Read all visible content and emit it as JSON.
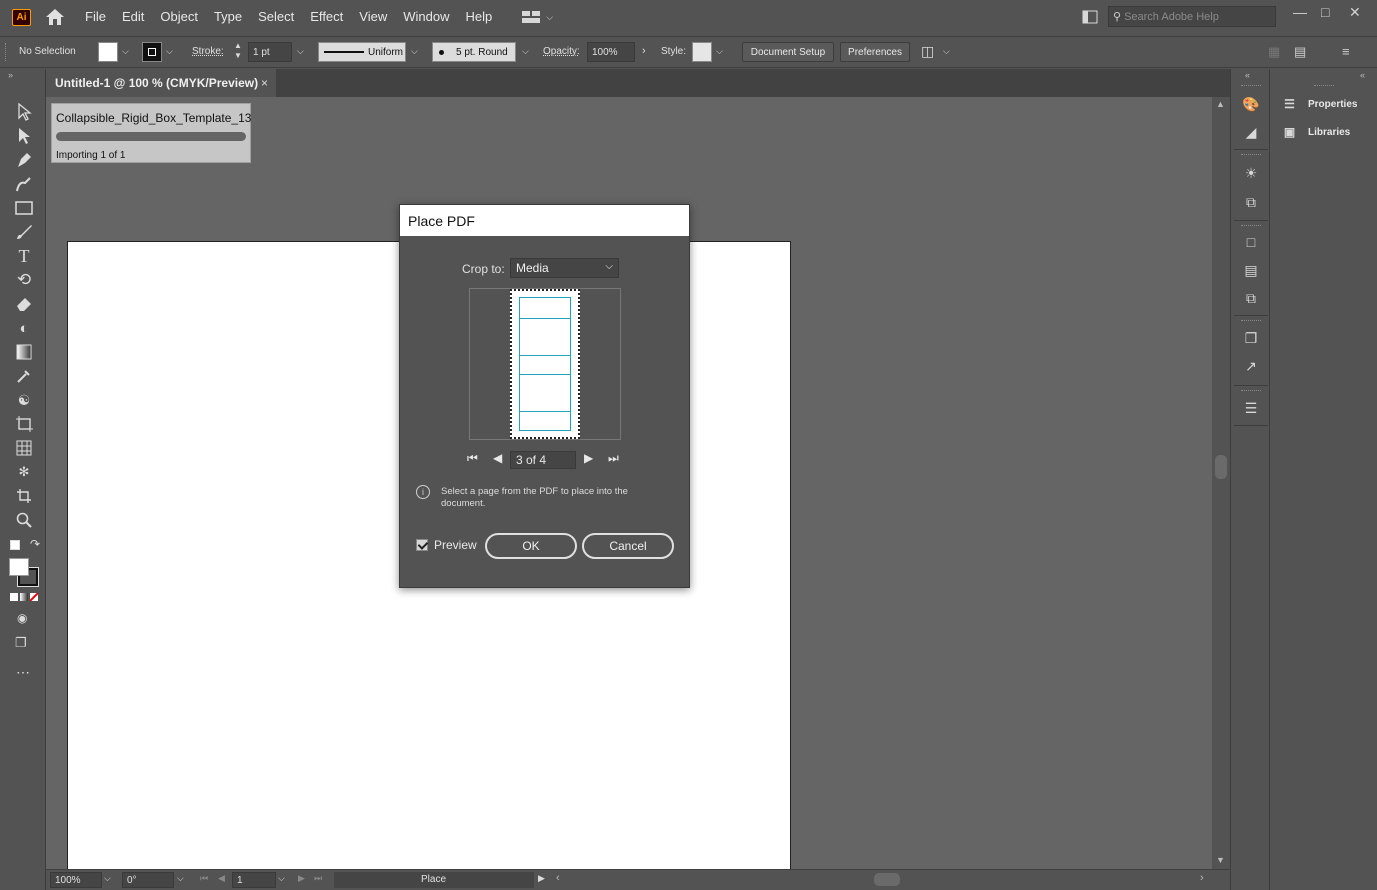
{
  "app": {
    "logo": "Ai",
    "menu": [
      "File",
      "Edit",
      "Object",
      "Type",
      "Select",
      "Effect",
      "View",
      "Window",
      "Help"
    ],
    "search_placeholder": "Search Adobe Help"
  },
  "control_bar": {
    "selection": "No Selection",
    "stroke_label": "Stroke:",
    "stroke_weight": "1 pt",
    "profile": "Uniform",
    "brush": "5 pt. Round",
    "opacity_label": "Opacity:",
    "opacity": "100%",
    "style_label": "Style:",
    "document_setup": "Document Setup",
    "preferences": "Preferences"
  },
  "document": {
    "tab_title": "Untitled-1 @ 100 % (CMYK/Preview)",
    "tab_close": "×"
  },
  "import_progress": {
    "filename": "Collapsible_Rigid_Box_Template_13",
    "status": "Importing 1 of 1"
  },
  "dialog": {
    "title": "Place PDF",
    "crop_label": "Crop to:",
    "crop_value": "Media",
    "page_indicator": "3 of 4",
    "info": "Select a page from the PDF to place into the document.",
    "preview_label": "Preview",
    "preview_checked": true,
    "ok": "OK",
    "cancel": "Cancel"
  },
  "status_bar": {
    "zoom": "100%",
    "rotation": "0°",
    "artboard": "1",
    "tool": "Place"
  },
  "right_panel": {
    "items": [
      "Properties",
      "Libraries"
    ]
  },
  "icons": {
    "tools": [
      "selection-icon",
      "direct-selection-icon",
      "pen-icon",
      "curvature-icon",
      "rectangle-icon",
      "paintbrush-icon",
      "type-icon",
      "rotate-icon",
      "eraser-icon",
      "shape-builder-icon",
      "gradient-icon",
      "eyedropper-icon",
      "blend-icon",
      "artboard-icon",
      "graph-icon",
      "symbol-sprayer-icon",
      "crop-icon",
      "zoom-icon"
    ]
  },
  "colors": {
    "accent_orange": "#ff9a00",
    "template_cyan": "#21a5bb"
  }
}
